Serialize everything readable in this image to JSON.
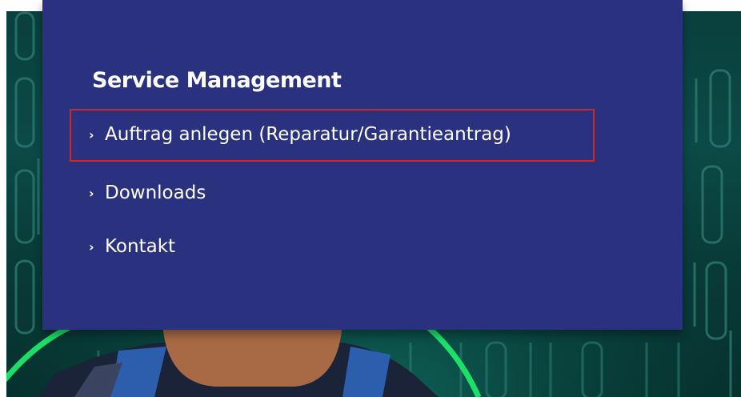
{
  "menu": {
    "title": "Service Management",
    "items": [
      {
        "label": "Auftrag anlegen (Reparatur/Garantieantrag)",
        "icon": "chevron-right-icon",
        "highlighted": true
      },
      {
        "label": "Downloads",
        "icon": "chevron-right-icon",
        "highlighted": false
      },
      {
        "label": "Kontakt",
        "icon": "chevron-right-icon",
        "highlighted": false
      }
    ]
  },
  "colors": {
    "menu_background": "#2a3280",
    "menu_text": "#ffffff",
    "highlight_border": "#d0262e",
    "hero_background": "#0a3f3d",
    "hero_accent_green": "#1ee86a"
  }
}
